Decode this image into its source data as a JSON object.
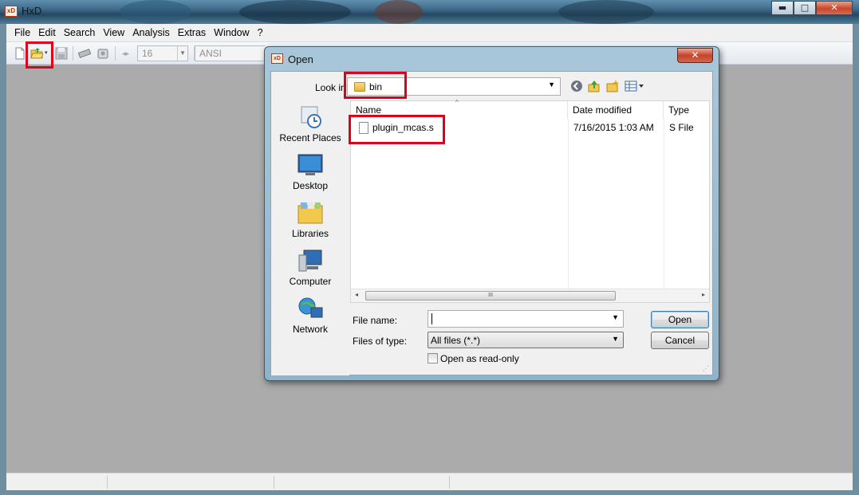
{
  "app": {
    "title": "HxD"
  },
  "window_controls": {
    "minimize": "▬",
    "maximize": "□",
    "close": "✕"
  },
  "menubar": [
    "File",
    "Edit",
    "Search",
    "View",
    "Analysis",
    "Extras",
    "Window",
    "?"
  ],
  "toolbar": {
    "icons": [
      "new-file-icon",
      "open-file-icon",
      "save-icon",
      "ram-chip-icon",
      "disk-icon",
      "bytes-per-row-icon"
    ],
    "bytes_per_row": "16",
    "charset": "ANSI"
  },
  "dialog": {
    "title": "Open",
    "icon_text": "xD",
    "close": "✕",
    "look_in_label": "Look in:",
    "look_in_value": "bin",
    "places": [
      "Recent Places",
      "Desktop",
      "Libraries",
      "Computer",
      "Network"
    ],
    "columns": [
      "Name",
      "Date modified",
      "Type"
    ],
    "files": [
      {
        "name": "plugin_mcas.s",
        "date": "7/16/2015 1:03 AM",
        "type": "S File"
      }
    ],
    "scroll_thumb": "III",
    "file_name_label": "File name:",
    "file_name_value": "",
    "files_of_type_label": "Files of type:",
    "files_of_type_value": "All files (*.*)",
    "read_only_label": "Open as read-only",
    "open_button": "Open",
    "cancel_button": "Cancel"
  },
  "colors": {
    "highlight": "#e0001b",
    "workspace": "#ababab",
    "dialog_frame": "#9bbcd1"
  }
}
